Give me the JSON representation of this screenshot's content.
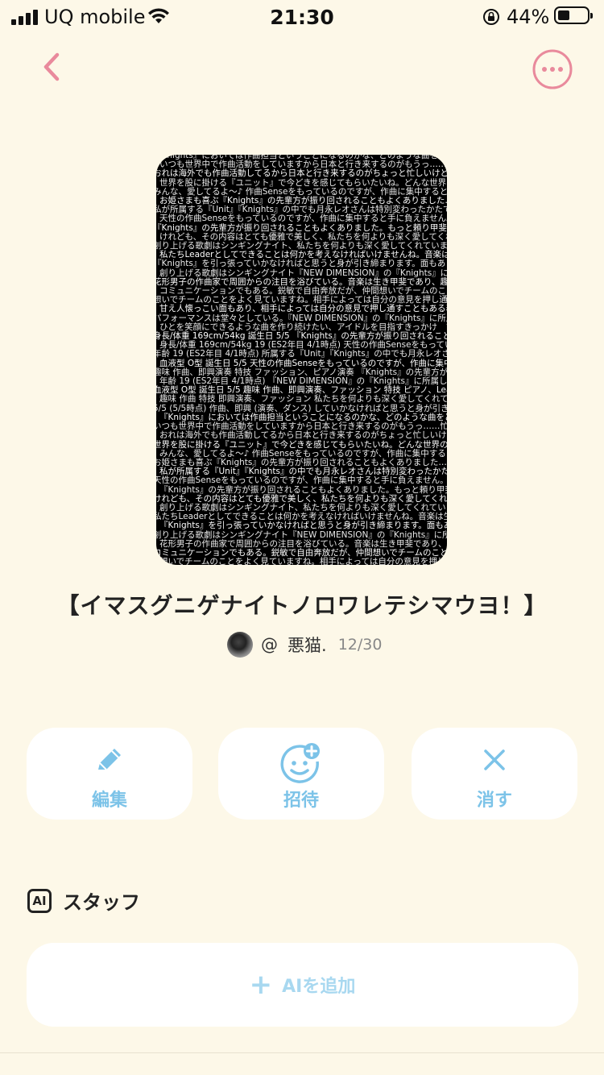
{
  "status_bar": {
    "carrier": "UQ mobile",
    "time": "21:30",
    "battery": "44%",
    "battery_level": 0.44
  },
  "nav": {
    "back_icon": "chevron-left-icon",
    "more_icon": "more-horizontal-icon",
    "accent_color": "#e98a9c"
  },
  "cover": {
    "lines": [
      "『Knights』においては作曲担当ということになるのかな、どのような曲をどとげるから、応援よろしくね",
      "いつも世界中で作曲活動をしていますから日本と行き来するのがもうっ……忙しいんだよね〜",
      "おれは海外でも作曲活動してるから日本と行き来するのがちょっと忙しいけど、ぜひ応援してね",
      "世界を股に掛ける『ユニット』で今どきを感じてもらいたいね。どんな世界のお姫さまも喜ぶような曲をとどけるから",
      "みんな、愛してるよ〜♪ 作曲Senseをもっているのですが、作曲に集中すると手に負えません",
      "お姫さまも喜ぶ『Knights』の先輩方が振り回されることもよくありました……",
      "私が所属する『Unit』『Knights』の中でも月永レオさんは特別変わったかたです。何よりも",
      "天性の作曲Senseをもっているのですが、作曲に集中すると手に負えません。しかも深い",
      "『Knights』の先輩方が振り回されることもよくありました。もっと頼り甲斐のある",
      "けれども、その内容はとても優雅で美しく、私たちを何よりも深く愛してくれています",
      "創り上げる歌劇はシンギングナイト、私たちを何よりも深く愛してくれています",
      "私たちLeaderとしてできることは何かを考えなければいけませんね。音楽は生き甲斐であり",
      "『Knights』を引っ張っていかなければと思うと身が引き締まります。面もあり、相手によって",
      "創り上げる歌劇はシンギングナイト『NEW DIMENSION』の『Knights』に所属している",
      "花形男子の作曲家で周囲からの注目を浴びている。音楽は生き甲斐であり、趣味と実益を兼ねる",
      "コミュニケーションでもある。鋭敏で自由奔放だが、仲間想いでチームのことがよく見える",
      "想いでチームのことをよく見ていますね。相手によっては自分の意見を押し通す",
      "甘え人懐っこい面もあり、相手によっては自分の意見で押し通すこともある表情豊かな少年",
      "パフォーマンスは堂々としている。『NEW DIMENSION』の『Knights』に所属している",
      "ひとを笑顔にできるような曲を作り続けたい、アイドルを目指すきっかけ",
      "身長/体重 169cm/54kg 誕生日 5/5 『Knights』の先輩方が振り回されることもよく",
      "身長/体重 169cm/54kg 19 (ES2年目 4/1時点) 天性の作曲Senseをもっているのですが",
      "年齢 19 (ES2年目 4/1時点) 所属する『Unit』『Knights』の中でも月永レオさんは特別",
      "血液型 O型 誕生日 5/5 天性の作曲Senseをもっているのですが、作曲に集中すると手に",
      "趣味 作曲、即興演奏 特技 ファッション、ピアノ演奏 『Knights』の先輩方が振り回される",
      "年齢 19 (ES2年目 4/1時点) 『NEW DIMENSION』の『Knights』に所属している",
      "血液型 O型 誕生日 5/5 趣味 作曲、即興演奏、ファッション 特技 ピアノ、Leaderとして",
      "趣味 作曲 特技 即興演奏、ファッション 私たちを何よりも深く愛してくれています",
      "5/5 (5/5時点) 作曲、即興 (演奏、ダンス) していかなければと思うと身が引き締まります"
    ]
  },
  "title": "【イマスグニゲナイトノロワレテシマウヨ！】",
  "author": {
    "at": "@",
    "name": "悪猫.",
    "date": "12/30"
  },
  "actions": [
    {
      "label": "編集",
      "icon": "pencil-icon"
    },
    {
      "label": "招待",
      "icon": "invite-smiley-plus-icon"
    },
    {
      "label": "消す",
      "icon": "close-icon"
    }
  ],
  "staff": {
    "badge": "AI",
    "title": "スタッフ",
    "add_label": "AIを追加"
  },
  "colors": {
    "background": "#fdf8e8",
    "action_blue": "#7cc3e8",
    "add_blue": "#a8d8f0"
  }
}
